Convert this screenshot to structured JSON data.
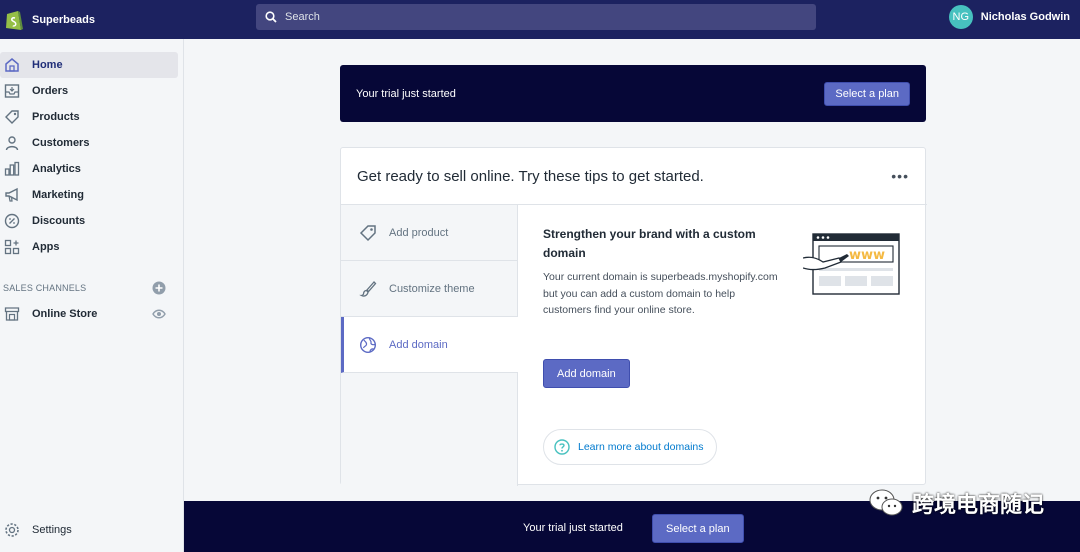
{
  "topbar": {
    "store_name": "Superbeads",
    "search_placeholder": "Search",
    "user_initials": "NG",
    "user_name": "Nicholas Godwin"
  },
  "sidebar": {
    "items": [
      {
        "label": "Home",
        "icon": "home-icon"
      },
      {
        "label": "Orders",
        "icon": "orders-icon"
      },
      {
        "label": "Products",
        "icon": "tag-icon"
      },
      {
        "label": "Customers",
        "icon": "person-icon"
      },
      {
        "label": "Analytics",
        "icon": "bar-chart-icon"
      },
      {
        "label": "Marketing",
        "icon": "megaphone-icon"
      },
      {
        "label": "Discounts",
        "icon": "discount-icon"
      },
      {
        "label": "Apps",
        "icon": "apps-icon"
      }
    ],
    "sales_channels_title": "SALES CHANNELS",
    "online_store_label": "Online Store",
    "settings_label": "Settings"
  },
  "banner": {
    "text": "Your trial just started",
    "button": "Select a plan"
  },
  "card": {
    "title": "Get ready to sell online. Try these tips to get started.",
    "menu": "•••",
    "tabs": [
      {
        "label": "Add product",
        "icon": "tag-icon"
      },
      {
        "label": "Customize theme",
        "icon": "brush-icon"
      },
      {
        "label": "Add domain",
        "icon": "globe-icon"
      }
    ],
    "panel_title": "Strengthen your brand with a custom domain",
    "panel_body": "Your current domain is superbeads.myshopify.com but you can add a custom domain to help customers find your online store.",
    "panel_button": "Add domain",
    "learn_link": "Learn more about domains"
  },
  "bottom_bar": {
    "text": "Your trial just started",
    "button": "Select a plan"
  },
  "watermark": {
    "text": "跨境电商随记"
  },
  "colors": {
    "topbar": "#1c2260",
    "banner": "#060737",
    "accent": "#5c6ac4",
    "link": "#007ace",
    "avatar": "#47c1bf"
  }
}
